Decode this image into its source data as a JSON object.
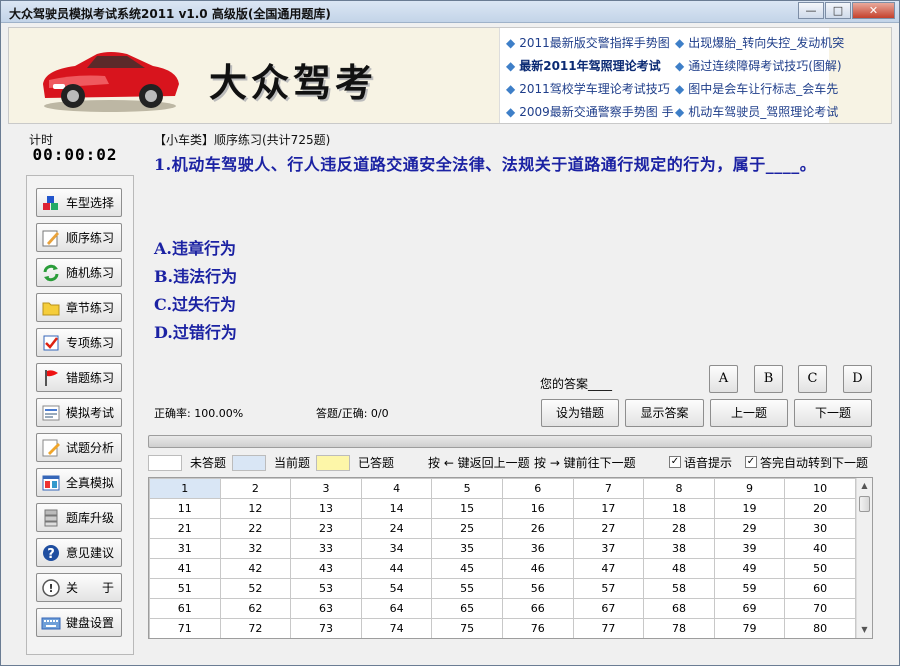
{
  "window": {
    "title": "大众驾驶员模拟考试系统2011 v1.0 高级版(全国通用题库)",
    "btn_min": "—",
    "btn_max": "□",
    "btn_close": "✕"
  },
  "banner": {
    "logo": "大众驾考",
    "news_left": [
      "2011最新版交警指挥手势图",
      "最新2011年驾照理论考试",
      "2011驾校学车理论考试技巧",
      "2009最新交通警察手势图 手"
    ],
    "news_right": [
      "出现爆胎_转向失控_发动机突",
      "通过连续障碍考试技巧(图解)",
      "图中是会车让行标志_会车先",
      "机动车驾驶员_驾照理论考试"
    ]
  },
  "sidebar": {
    "timer_label": "计时",
    "timer_value": "00:00:02",
    "buttons": [
      {
        "label": "车型选择",
        "icon": "cubes-icon"
      },
      {
        "label": "顺序练习",
        "icon": "pencil-note-icon"
      },
      {
        "label": "随机练习",
        "icon": "refresh-icon"
      },
      {
        "label": "章节练习",
        "icon": "folder-icon"
      },
      {
        "label": "专项练习",
        "icon": "checklist-icon"
      },
      {
        "label": "错题练习",
        "icon": "red-flag-icon"
      },
      {
        "label": "模拟考试",
        "icon": "form-icon"
      },
      {
        "label": "试题分析",
        "icon": "edit-icon"
      },
      {
        "label": "全真模拟",
        "icon": "window-icon"
      },
      {
        "label": "题库升级",
        "icon": "database-icon"
      },
      {
        "label": "意见建议",
        "icon": "question-icon"
      },
      {
        "label": "关　　于",
        "icon": "info-icon"
      },
      {
        "label": "键盘设置",
        "icon": "keyboard-icon"
      }
    ]
  },
  "question": {
    "header": "【小车类】顺序练习(共计725题)",
    "text": "1.机动车驾驶人、行人违反道路交通安全法律、法规关于道路通行规定的行为，属于____。",
    "options": [
      "A.违章行为",
      "B.违法行为",
      "C.过失行为",
      "D.过错行为"
    ]
  },
  "answer": {
    "label": "您的答案____",
    "choices": [
      "A",
      "B",
      "C",
      "D"
    ]
  },
  "stats": {
    "accuracy": "正确率: 100.00%",
    "answered": "答题/正确: 0/0"
  },
  "actions": {
    "mark_wrong": "设为错题",
    "show_answer": "显示答案",
    "prev": "上一题",
    "next": "下一题"
  },
  "legend": {
    "unanswered": "未答题",
    "current": "当前题",
    "answered": "已答题",
    "key_hint_prev": "按 ← 键返回上一题",
    "key_hint_next": "按 → 键前往下一题",
    "voice": "语音提示",
    "auto_next": "答完自动转到下一题",
    "voice_checked": true,
    "auto_next_checked": true
  },
  "colors": {
    "unanswered": "#ffffff",
    "current": "#d9e6f5",
    "answered": "#fdf6a8",
    "question_text": "#1b22a3"
  },
  "grid": {
    "current": 1,
    "rows": [
      [
        1,
        2,
        3,
        4,
        5,
        6,
        7,
        8,
        9,
        10
      ],
      [
        11,
        12,
        13,
        14,
        15,
        16,
        17,
        18,
        19,
        20
      ],
      [
        21,
        22,
        23,
        24,
        25,
        26,
        27,
        28,
        29,
        30
      ],
      [
        31,
        32,
        33,
        34,
        35,
        36,
        37,
        38,
        39,
        40
      ],
      [
        41,
        42,
        43,
        44,
        45,
        46,
        47,
        48,
        49,
        50
      ],
      [
        51,
        52,
        53,
        54,
        55,
        56,
        57,
        58,
        59,
        60
      ],
      [
        61,
        62,
        63,
        64,
        65,
        66,
        67,
        68,
        69,
        70
      ],
      [
        71,
        72,
        73,
        74,
        75,
        76,
        77,
        78,
        79,
        80
      ]
    ]
  }
}
